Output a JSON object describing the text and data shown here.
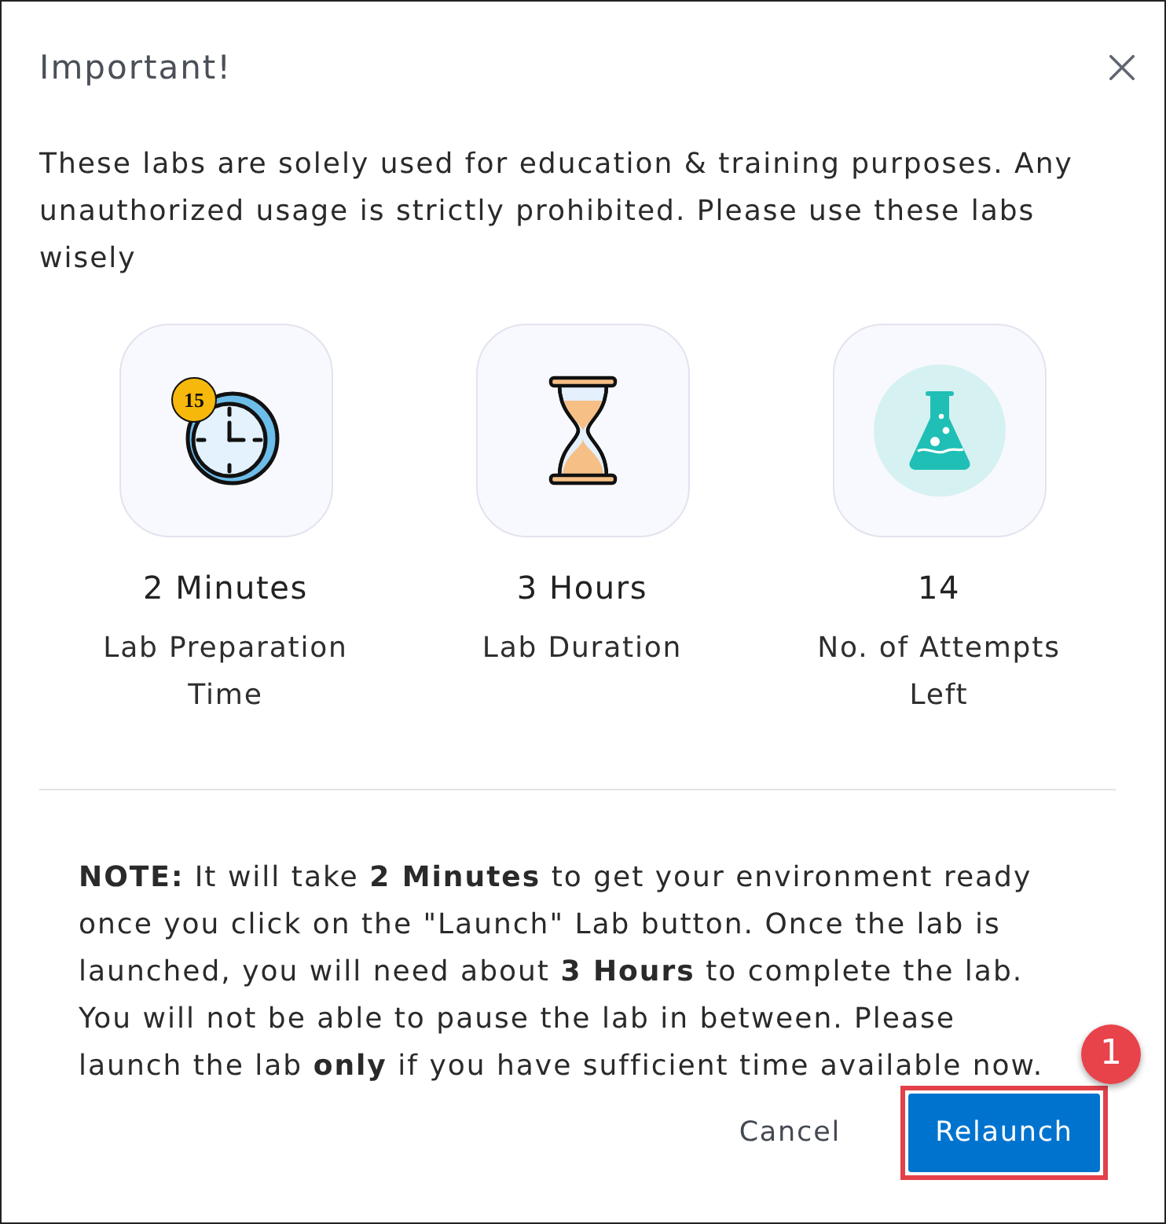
{
  "dialog": {
    "title": "Important!"
  },
  "intro": "These labs are solely used for education & training purposes. Any unauthorized usage is strictly prohibited. Please use these labs wisely",
  "stats": [
    {
      "kind": "clock",
      "icon_badge": "15",
      "value": "2 Minutes",
      "label": "Lab Preparation Time"
    },
    {
      "kind": "hourglass",
      "value": "3 Hours",
      "label": "Lab Duration"
    },
    {
      "kind": "flask",
      "value": "14",
      "label": "No. of Attempts Left"
    }
  ],
  "note": "**NOTE:** It will take **2 Minutes** to get your environment ready once you click on the \"Launch\" Lab button. Once the lab is launched, you will need about **3 Hours** to complete the lab. You will not be able to pause the lab in between. Please launch the lab **only** if you have sufficient time available now.",
  "buttons": [
    {
      "kind": "text",
      "label": "Cancel",
      "highlighted": false
    },
    {
      "kind": "primary",
      "label": "Relaunch",
      "highlighted": true,
      "badge": "1"
    }
  ]
}
